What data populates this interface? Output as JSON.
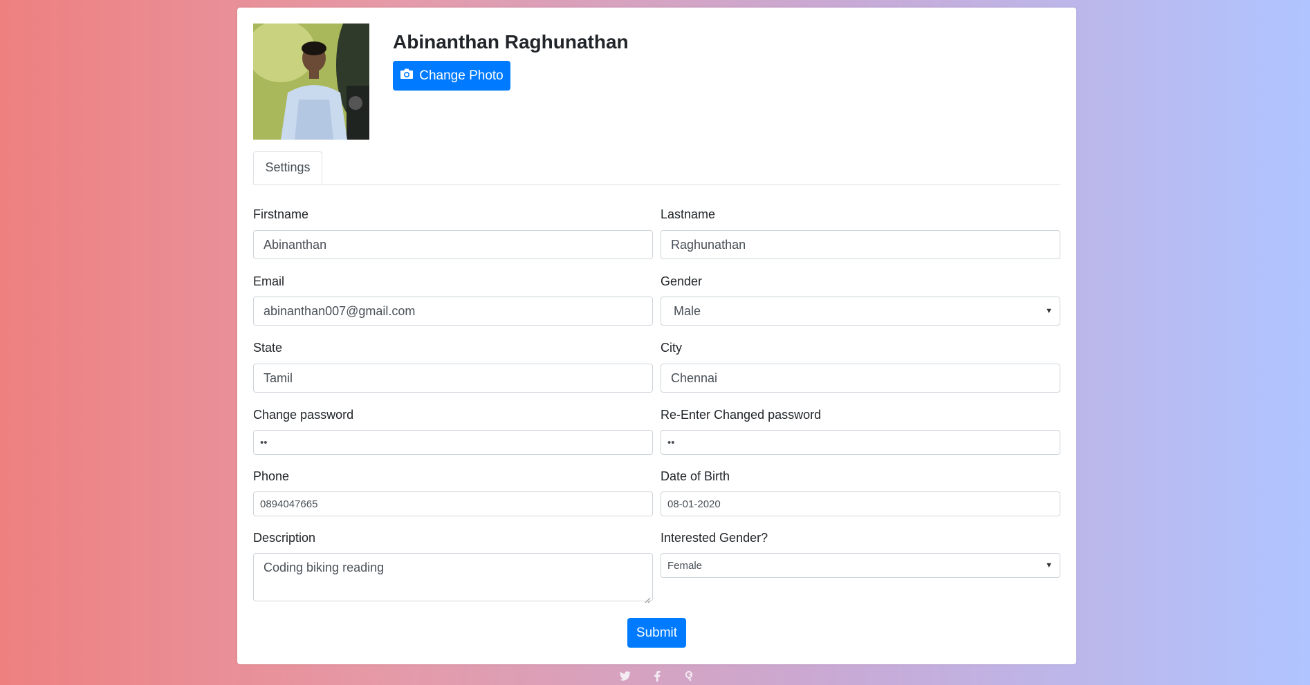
{
  "profile": {
    "name": "Abinanthan Raghunathan",
    "change_photo_label": "Change Photo"
  },
  "tabs": [
    {
      "label": "Settings",
      "active": true
    }
  ],
  "form": {
    "firstname": {
      "label": "Firstname",
      "value": "Abinanthan"
    },
    "lastname": {
      "label": "Lastname",
      "value": "Raghunathan"
    },
    "email": {
      "label": "Email",
      "value": "abinanthan007@gmail.com"
    },
    "gender": {
      "label": "Gender",
      "value": "Male"
    },
    "state": {
      "label": "State",
      "value": "Tamil"
    },
    "city": {
      "label": "City",
      "value": "Chennai"
    },
    "password": {
      "label": "Change password",
      "value": "••"
    },
    "password_confirm": {
      "label": "Re-Enter Changed password",
      "value": "••"
    },
    "phone": {
      "label": "Phone",
      "value": "0894047665"
    },
    "dob": {
      "label": "Date of Birth",
      "value": "08-01-2020"
    },
    "description": {
      "label": "Description",
      "value": "Coding biking reading"
    },
    "interested_gender": {
      "label": "Interested Gender?",
      "value": "Female"
    },
    "submit_label": "Submit"
  },
  "social_icons": [
    "twitter-icon",
    "facebook-icon",
    "google-plus-icon"
  ],
  "colors": {
    "primary": "#007bff",
    "background_left": "#ee8080",
    "background_right": "#b0c4ff"
  }
}
